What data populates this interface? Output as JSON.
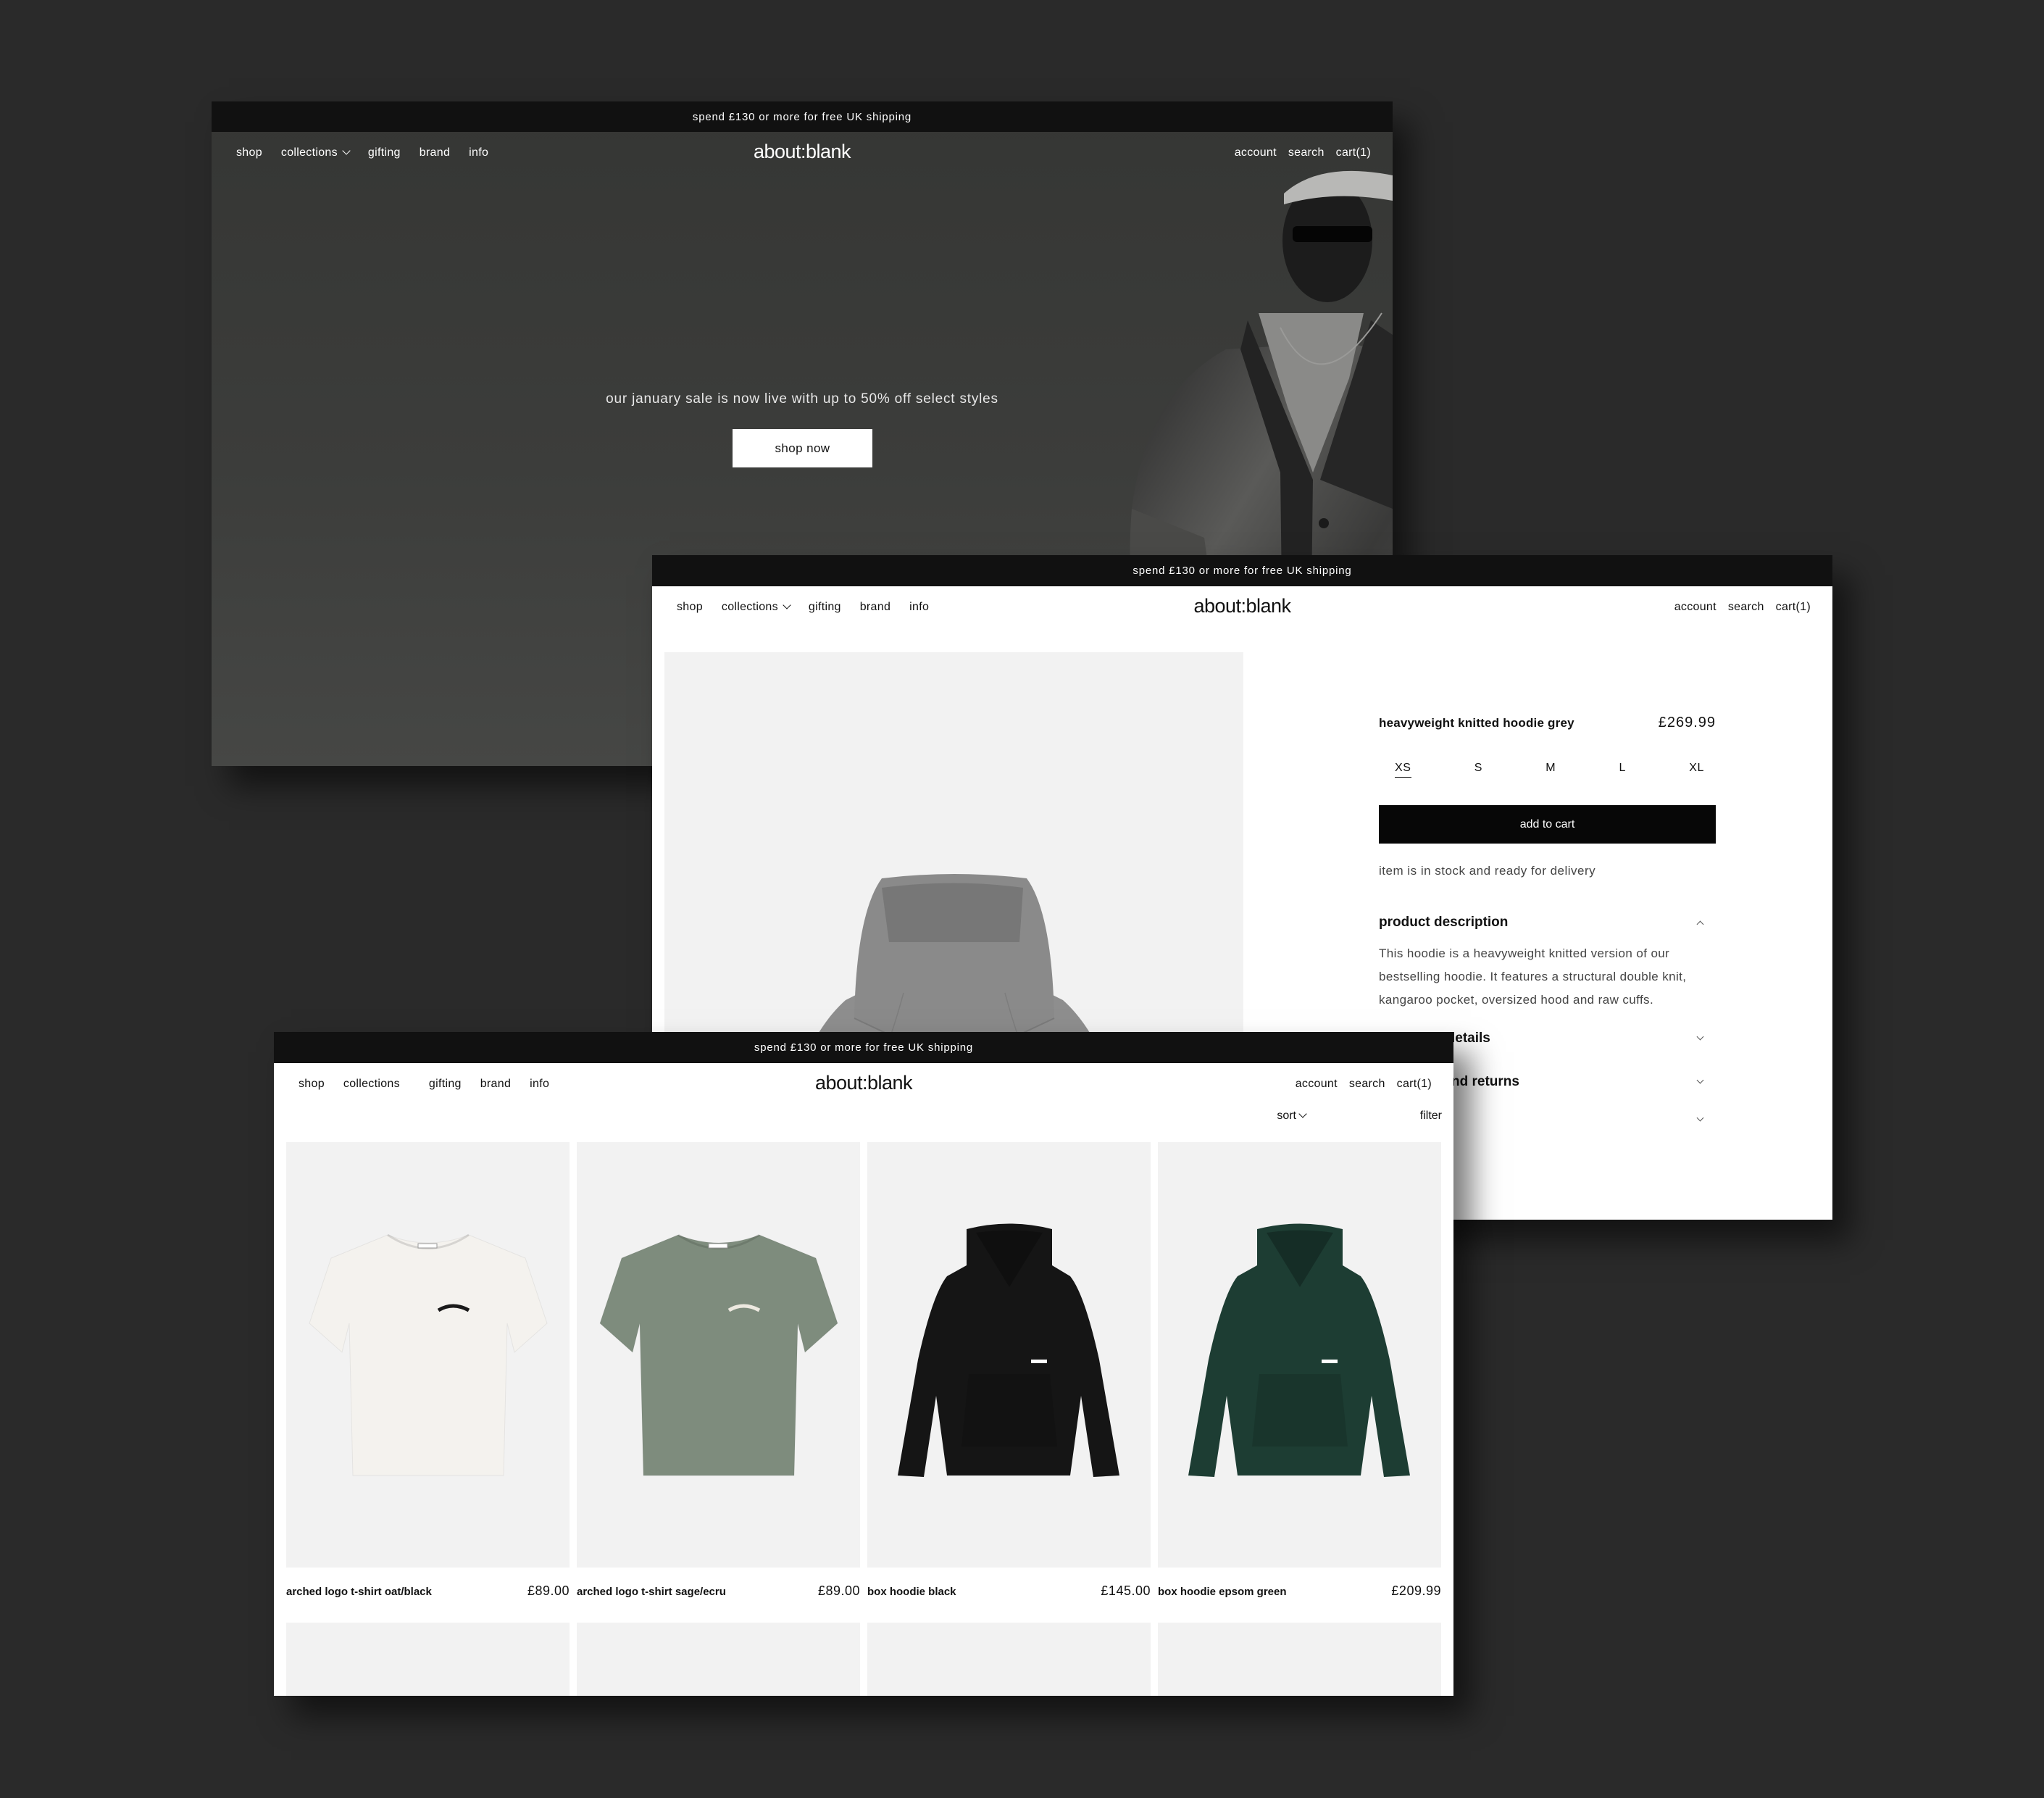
{
  "shared": {
    "announcement": "spend £130 or more for free UK shipping",
    "logo": "about:blank",
    "nav_left": [
      "shop",
      "collections",
      "gifting",
      "brand",
      "info"
    ],
    "nav_right": [
      "account",
      "search",
      "cart(1)"
    ]
  },
  "home": {
    "hero_text": "our january sale is now live with up to 50% off select styles",
    "cta_label": "shop now",
    "hero_image": "model-in-knit-cardigan-photo"
  },
  "product": {
    "title": "heavyweight knitted hoodie grey",
    "price": "£269.99",
    "sizes": [
      "XS",
      "S",
      "M",
      "L",
      "XL"
    ],
    "selected_size": "XS",
    "add_to_cart_label": "add to cart",
    "stock_status": "item is in stock and ready for delivery",
    "accordion": [
      {
        "title": "product description",
        "expanded": true,
        "body": "This hoodie is a heavyweight knitted version of our bestselling hoodie. It features a structural double knit, kangaroo pocket, oversized hood and raw cuffs."
      },
      {
        "title": "details",
        "visible_fragment": "letails",
        "expanded": false
      },
      {
        "title": "returns",
        "visible_fragment": "nd returns",
        "expanded": false
      },
      {
        "title": "",
        "expanded": false
      }
    ],
    "image_color": "#8e8e8e"
  },
  "collection": {
    "sort_label": "sort",
    "filter_label": "filter",
    "products": [
      {
        "name": "arched logo t-shirt oat/black",
        "price": "£89.00",
        "type": "tshirt",
        "color": "#f4f2ee",
        "print": "#1a1a1a"
      },
      {
        "name": "arched logo t-shirt sage/ecru",
        "price": "£89.00",
        "type": "tshirt",
        "color": "#7e8c7d",
        "print": "#ede9e0"
      },
      {
        "name": "box hoodie black",
        "price": "£145.00",
        "type": "hoodie",
        "color": "#151515",
        "print": "#ffffff"
      },
      {
        "name": "box hoodie epsom green",
        "price": "£209.99",
        "type": "hoodie",
        "color": "#1d3d33",
        "print": "#ffffff"
      }
    ],
    "placeholder_count": 4
  }
}
